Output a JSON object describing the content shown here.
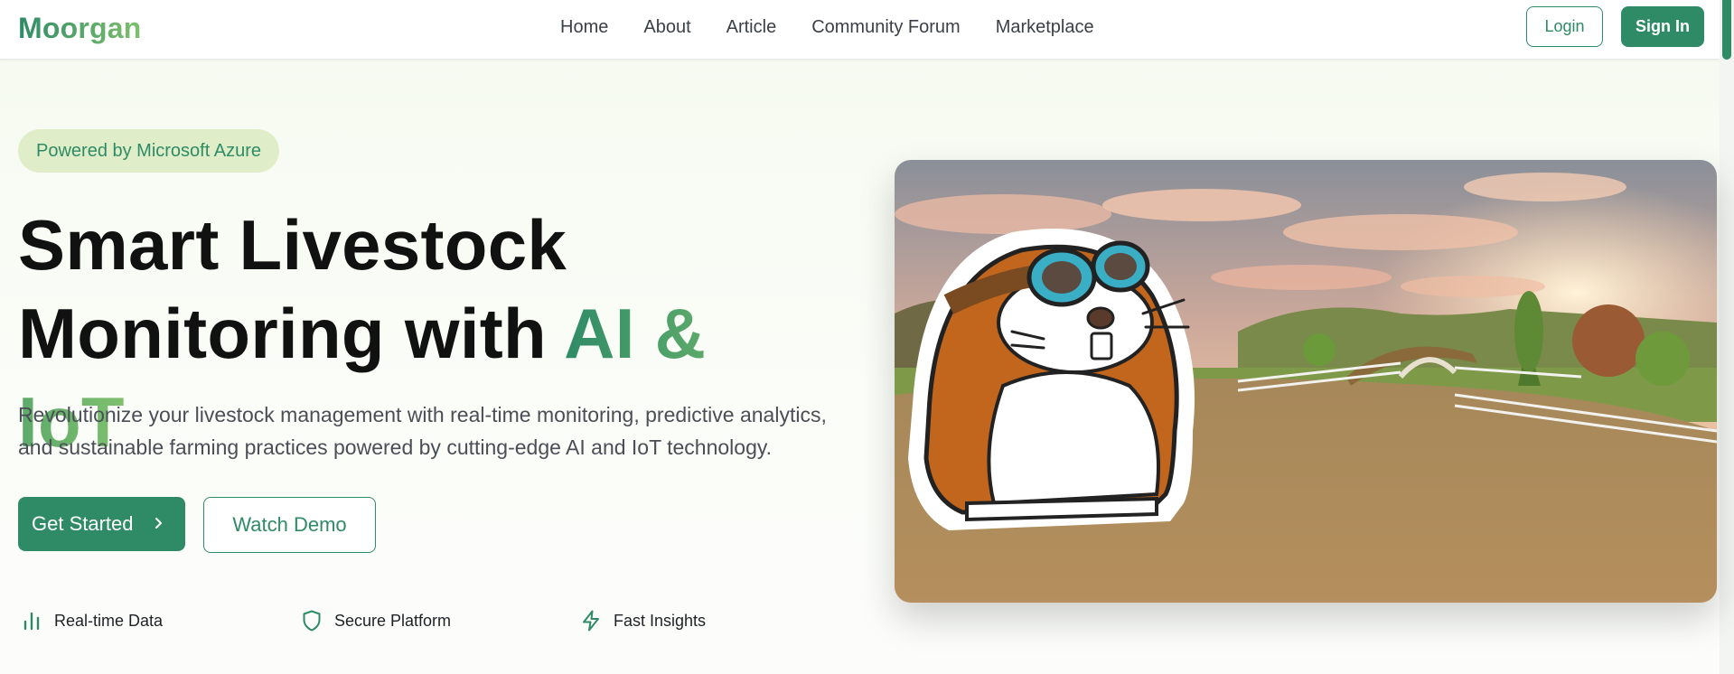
{
  "brand": {
    "name": "Moorgan"
  },
  "nav": {
    "links": [
      "Home",
      "About",
      "Article",
      "Community Forum",
      "Marketplace"
    ],
    "login_label": "Login",
    "signin_label": "Sign In"
  },
  "hero": {
    "badge": "Powered by Microsoft Azure",
    "headline_line1": "Smart Livestock",
    "headline_line2_prefix": "Monitoring with",
    "headline_accent": "AI & IoT",
    "subtext": "Revolutionize your livestock management with real-time monitoring, predictive analytics, and sustainable farming practices powered by cutting-edge AI and IoT technology.",
    "cta_primary": "Get Started",
    "cta_secondary": "Watch Demo",
    "features": [
      {
        "label": "Real-time Data",
        "icon": "bar-chart-icon"
      },
      {
        "label": "Secure Platform",
        "icon": "shield-icon"
      },
      {
        "label": "Fast Insights",
        "icon": "lightning-icon"
      }
    ]
  },
  "colors": {
    "brand_green": "#2f8b66",
    "accent_light_green": "#7fc06e",
    "badge_bg": "#dfeec8"
  }
}
